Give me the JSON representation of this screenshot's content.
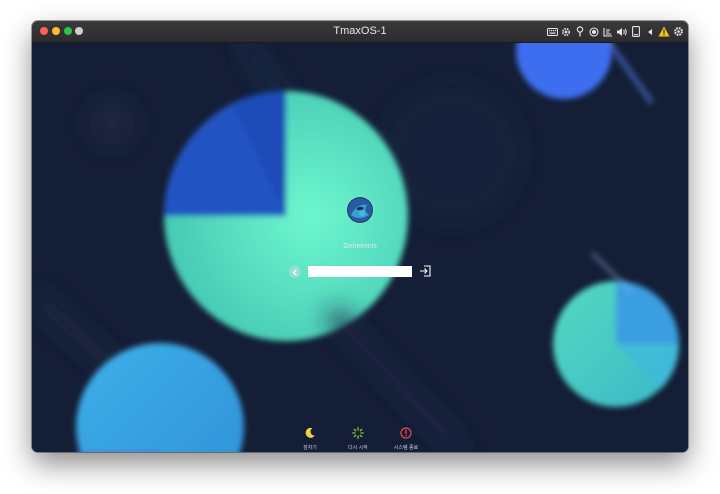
{
  "window": {
    "title": "TmaxOS-1"
  },
  "tray": {
    "icons": [
      "keyboard-icon",
      "settings-cog-icon",
      "pin-icon",
      "record-icon",
      "network-icon",
      "volume-icon",
      "tablet-icon",
      "arrow-left-icon",
      "warning-icon",
      "gear-icon"
    ]
  },
  "login": {
    "username": "Geheimnis",
    "password_value": ""
  },
  "power": {
    "sleep_label": "잠자기",
    "restart_label": "다시 시작",
    "shutdown_label": "시스템 종료"
  },
  "colors": {
    "background": "#141e36",
    "accent_teal": "#5ff0c0",
    "accent_blue": "#1e50c8",
    "warning": "#f5c518",
    "shutdown_red": "#e84a4a",
    "restart_green": "#8acb3c",
    "sleep_yellow": "#f2d23c"
  }
}
